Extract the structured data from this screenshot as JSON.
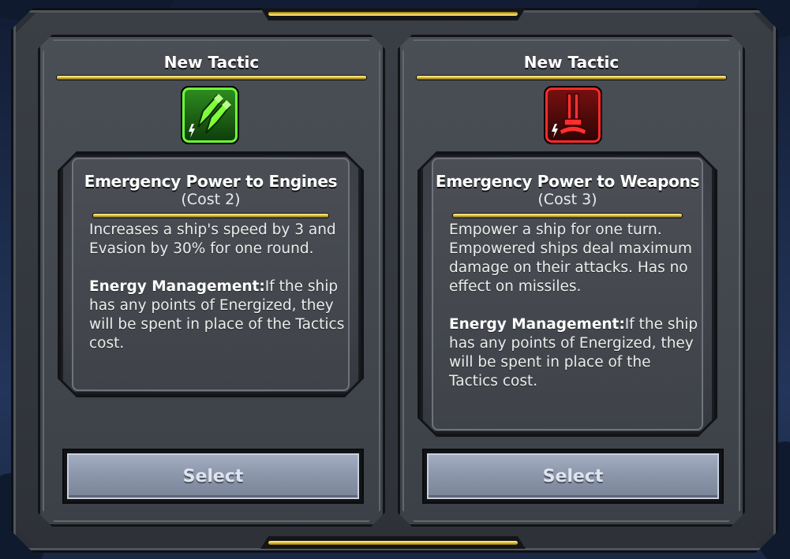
{
  "dialog": {
    "cards": [
      {
        "header": "New Tactic",
        "icon": "engines-boost-icon",
        "icon_color": "#6cff3a",
        "name": "Emergency Power to Engines",
        "cost": "(Cost 2)",
        "description": "Increases a ship's speed by 3 and Evasion by 30% for one round.",
        "mechanic_label": "Energy Management:",
        "mechanic_text": "If the ship has any points of Energized, they will be spent in place of the Tactics cost.",
        "button": "Select"
      },
      {
        "header": "New Tactic",
        "icon": "weapons-power-icon",
        "icon_color": "#ff2a2a",
        "name": "Emergency Power to Weapons",
        "cost": "(Cost 3)",
        "description": "Empower a ship for one turn. Empowered ships deal maximum damage on their attacks.  Has no effect on missiles.",
        "mechanic_label": "Energy Management:",
        "mechanic_text": "If the ship has any points of Energized, they will be spent in place of the Tactics cost.",
        "button": "Select"
      }
    ]
  }
}
